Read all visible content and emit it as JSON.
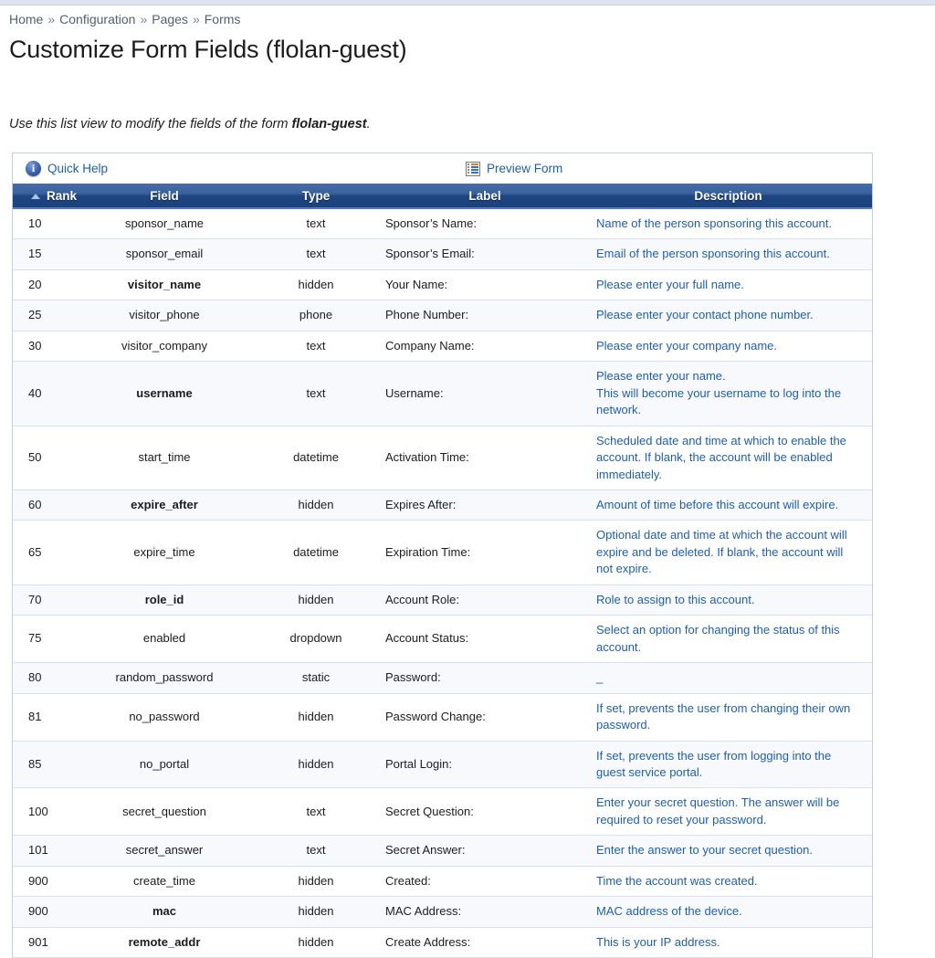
{
  "breadcrumb": {
    "separator": "»",
    "items": [
      "Home",
      "Configuration",
      "Pages",
      "Forms"
    ]
  },
  "page_title": "Customize Form Fields (flolan-guest)",
  "intro": {
    "before": "Use this list view to modify the fields of the form ",
    "form_name": "flolan-guest",
    "after": "."
  },
  "toolbar": {
    "quick_help": "Quick Help",
    "quick_help_icon": "info-icon",
    "preview_form": "Preview Form",
    "preview_form_icon": "form-preview-icon"
  },
  "table": {
    "sort_column": "Rank",
    "sort_direction": "ascending",
    "columns": [
      "Rank",
      "Field",
      "Type",
      "Label",
      "Description"
    ],
    "rows": [
      {
        "rank": "10",
        "field": "sponsor_name",
        "bold": false,
        "type": "text",
        "label": "Sponsor’s Name:",
        "description": [
          "Name of the person sponsoring this account."
        ]
      },
      {
        "rank": "15",
        "field": "sponsor_email",
        "bold": false,
        "type": "text",
        "label": "Sponsor’s Email:",
        "description": [
          "Email of the person sponsoring this account."
        ]
      },
      {
        "rank": "20",
        "field": "visitor_name",
        "bold": true,
        "type": "hidden",
        "label": "Your Name:",
        "description": [
          "Please enter your full name."
        ]
      },
      {
        "rank": "25",
        "field": "visitor_phone",
        "bold": false,
        "type": "phone",
        "label": "Phone Number:",
        "description": [
          "Please enter your contact phone number."
        ]
      },
      {
        "rank": "30",
        "field": "visitor_company",
        "bold": false,
        "type": "text",
        "label": "Company Name:",
        "description": [
          "Please enter your company name."
        ]
      },
      {
        "rank": "40",
        "field": "username",
        "bold": true,
        "type": "text",
        "label": "Username:",
        "description": [
          "Please enter your name.",
          "This will become your username to log into the network."
        ]
      },
      {
        "rank": "50",
        "field": "start_time",
        "bold": false,
        "type": "datetime",
        "label": "Activation Time:",
        "description": [
          "Scheduled date and time at which to enable the account. If blank, the account will be enabled immediately."
        ]
      },
      {
        "rank": "60",
        "field": "expire_after",
        "bold": true,
        "type": "hidden",
        "label": "Expires After:",
        "description": [
          "Amount of time before this account will expire."
        ]
      },
      {
        "rank": "65",
        "field": "expire_time",
        "bold": false,
        "type": "datetime",
        "label": "Expiration Time:",
        "description": [
          "Optional date and time at which the account will expire and be deleted. If blank, the account will not expire."
        ]
      },
      {
        "rank": "70",
        "field": "role_id",
        "bold": true,
        "type": "hidden",
        "label": "Account Role:",
        "description": [
          "Role to assign to this account."
        ]
      },
      {
        "rank": "75",
        "field": "enabled",
        "bold": false,
        "type": "dropdown",
        "label": "Account Status:",
        "description": [
          "Select an option for changing the status of this account."
        ]
      },
      {
        "rank": "80",
        "field": "random_password",
        "bold": false,
        "type": "static",
        "label": "Password:",
        "description": [
          "_"
        ]
      },
      {
        "rank": "81",
        "field": "no_password",
        "bold": false,
        "type": "hidden",
        "label": "Password Change:",
        "description": [
          "If set, prevents the user from changing their own password."
        ]
      },
      {
        "rank": "85",
        "field": "no_portal",
        "bold": false,
        "type": "hidden",
        "label": "Portal Login:",
        "description": [
          "If set, prevents the user from logging into the guest service portal."
        ]
      },
      {
        "rank": "100",
        "field": "secret_question",
        "bold": false,
        "type": "text",
        "label": "Secret Question:",
        "description": [
          "Enter your secret question. The answer will be required to reset your password."
        ]
      },
      {
        "rank": "101",
        "field": "secret_answer",
        "bold": false,
        "type": "text",
        "label": "Secret Answer:",
        "description": [
          "Enter the answer to your secret question."
        ]
      },
      {
        "rank": "900",
        "field": "create_time",
        "bold": false,
        "type": "hidden",
        "label": "Created:",
        "description": [
          "Time the account was created."
        ]
      },
      {
        "rank": "900",
        "field": "mac",
        "bold": true,
        "type": "hidden",
        "label": "MAC Address:",
        "description": [
          "MAC address of the device."
        ]
      },
      {
        "rank": "901",
        "field": "remote_addr",
        "bold": true,
        "type": "hidden",
        "label": "Create Address:",
        "description": [
          "This is your IP address."
        ]
      }
    ]
  },
  "colors": {
    "header_gradient_top": "#456da9",
    "header_gradient_bottom": "#1c407a",
    "link_blue": "#1f5fa9",
    "breadcrumb_gray": "#52606e",
    "row_alt": "#f7f9fc",
    "row_border": "#d7e0ee"
  }
}
